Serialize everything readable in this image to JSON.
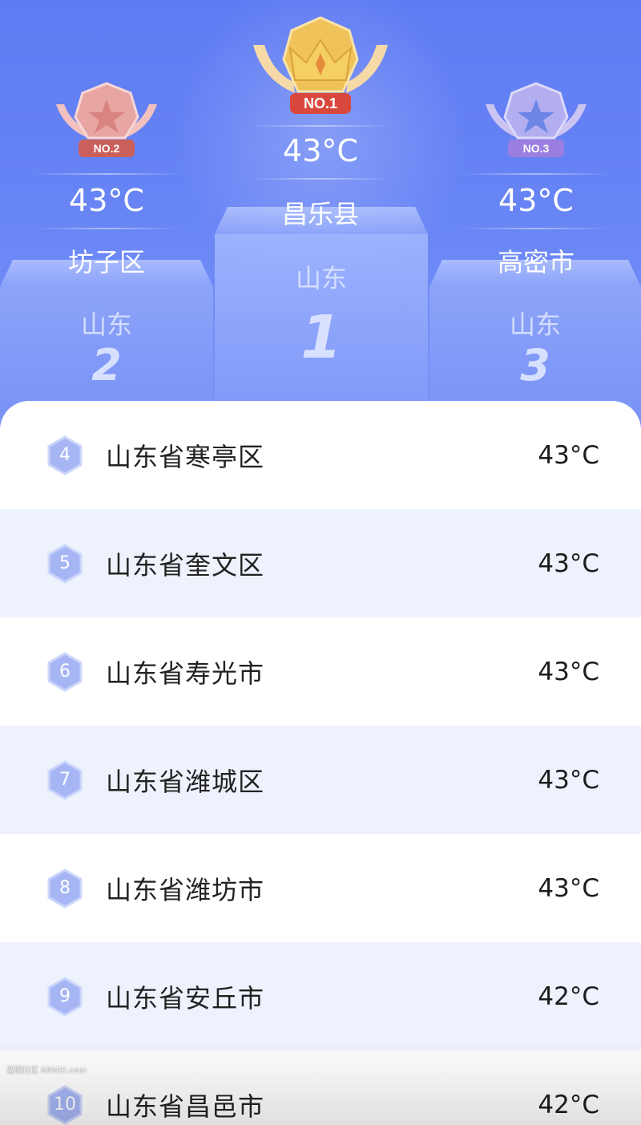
{
  "podium": [
    {
      "rank": "1",
      "badge_label": "NO.1",
      "temperature": "43°C",
      "city": "昌乐县",
      "province": "山东",
      "badge_color": "#e9b342"
    },
    {
      "rank": "2",
      "badge_label": "NO.2",
      "temperature": "43°C",
      "city": "坊子区",
      "province": "山东",
      "badge_color": "#e7a3a0"
    },
    {
      "rank": "3",
      "badge_label": "NO.3",
      "temperature": "43°C",
      "city": "高密市",
      "province": "山东",
      "badge_color": "#a9a6ea"
    }
  ],
  "list": [
    {
      "rank": "4",
      "name": "山东省寒亭区",
      "temperature": "43°C"
    },
    {
      "rank": "5",
      "name": "山东省奎文区",
      "temperature": "43°C"
    },
    {
      "rank": "6",
      "name": "山东省寿光市",
      "temperature": "43°C"
    },
    {
      "rank": "7",
      "name": "山东省潍城区",
      "temperature": "43°C"
    },
    {
      "rank": "8",
      "name": "山东省潍坊市",
      "temperature": "43°C"
    },
    {
      "rank": "9",
      "name": "山东省安丘市",
      "temperature": "42°C"
    },
    {
      "rank": "10",
      "name": "山东省昌邑市",
      "temperature": "42°C"
    }
  ],
  "colors": {
    "header_bg": "#6784f5",
    "rank_hex": "#a6b6f5",
    "alt_row": "#eef2fc"
  },
  "watermark": "留园社区 6PARK.com"
}
